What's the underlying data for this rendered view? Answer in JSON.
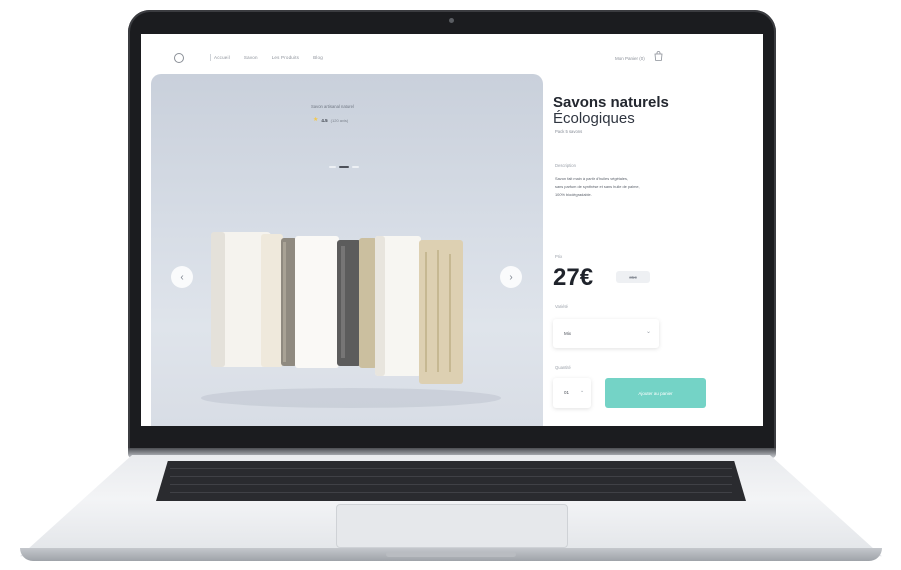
{
  "nav": {
    "links": [
      "Accueil",
      "Savon",
      "Les Produits",
      "Blog"
    ],
    "cart_label": "Mon Panier (0)",
    "cart_icon": "shopping-bag-icon",
    "logo_icon": "logo-circle-icon"
  },
  "hero": {
    "kicker": "Savon artisanal naturel",
    "rating_value": "4.5",
    "rating_count": "(120 avis)",
    "prev_icon": "chevron-left-icon",
    "next_icon": "chevron-right-icon",
    "slides_total": 3,
    "slide_active": 2
  },
  "product": {
    "title_line1": "Savons naturels",
    "title_line2": "Écologiques",
    "subtitle": "Pack 5 savons",
    "description_label": "Description",
    "description_lines": [
      "Savon fait main à partir d'huiles végétales,",
      "sans parfum de synthèse et sans huile de palme,",
      "100% biodégradable."
    ],
    "price_label": "Prix",
    "price": "27€",
    "old_price": "35€",
    "select_label": "Variété",
    "select_value": "Mix",
    "quantity_label": "Quantité",
    "quantity_value": "01",
    "add_button": "Ajouter au panier"
  },
  "colors": {
    "accent": "#74d3c6",
    "text_dark": "#23272f",
    "hero_bg": "#d3d9e2",
    "star": "#f3c84b"
  }
}
